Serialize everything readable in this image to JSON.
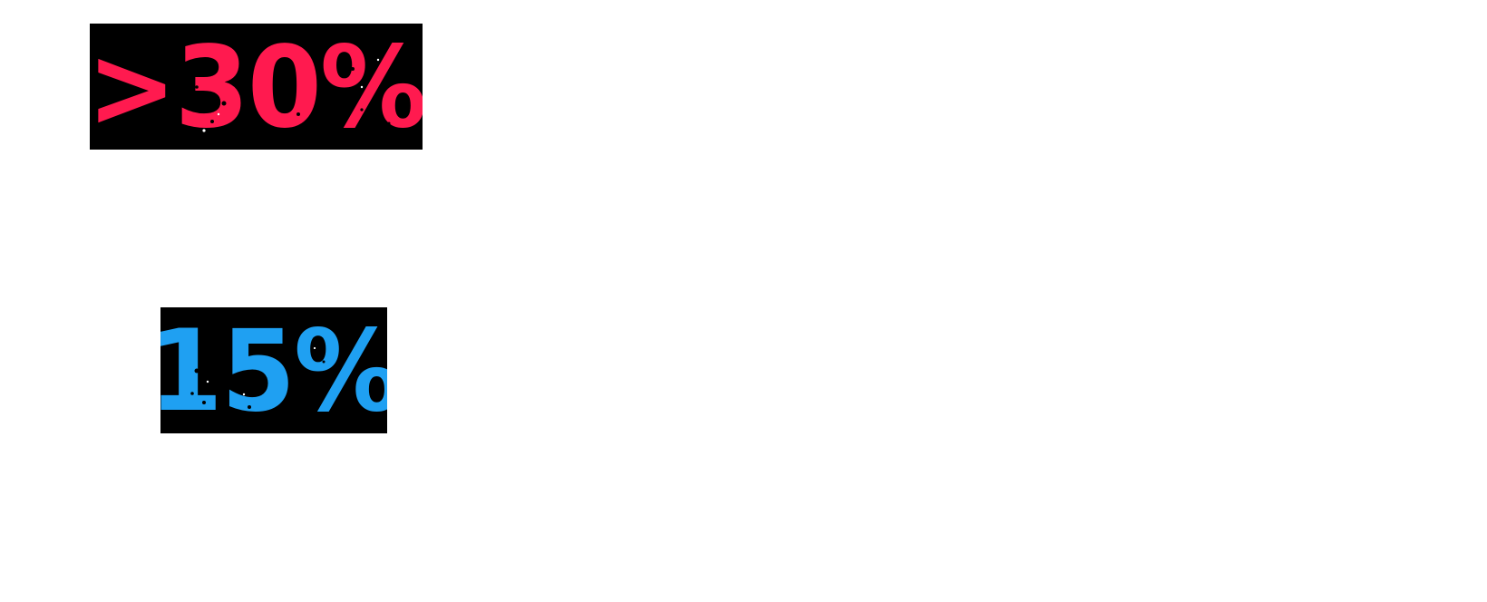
{
  "stats": [
    {
      "value_text": ">30%",
      "color": "#ff1a4f"
    },
    {
      "value_text": "15%",
      "color": "#1fa0f2"
    }
  ],
  "background_color": "#ffffff",
  "box_color": "#000000"
}
